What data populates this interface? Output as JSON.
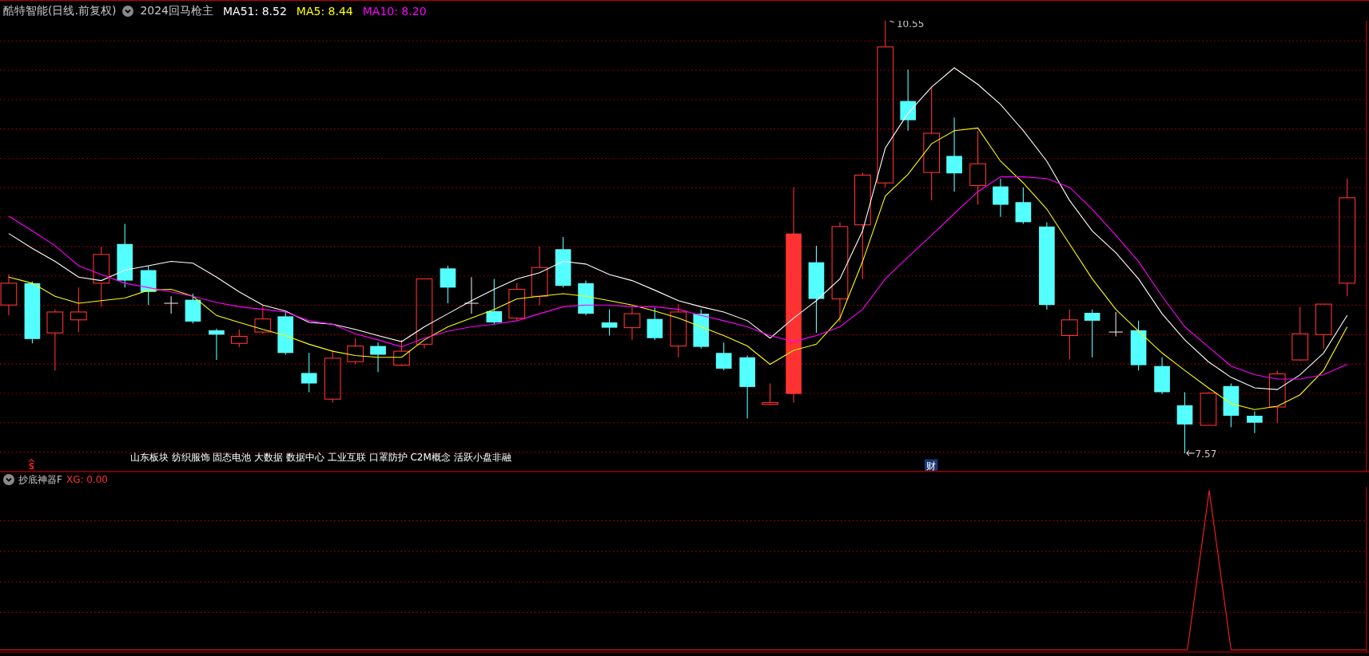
{
  "header": {
    "stock_name": "酷特智能(日线.前复权)",
    "indicator": "2024回马枪主",
    "moving_averages": [
      {
        "label": "MA51: 8.52",
        "color": "#ffffff"
      },
      {
        "label": "MA5: 8.44",
        "color": "#ffff00"
      },
      {
        "label": "MA10: 8.20",
        "color": "#ff00ff"
      }
    ]
  },
  "price_chart": {
    "high_label": "10.55",
    "low_label": "7.57",
    "concepts": "山东板块 纺织服饰 固态电池 大数据 数据中心 工业互联 口罩防护 C2M概念 活跃小盘非融",
    "signal_marker": "S",
    "finance_badge": "财"
  },
  "indicator_panel": {
    "name": "抄底神器F",
    "value": "XG: 0.00"
  }
}
